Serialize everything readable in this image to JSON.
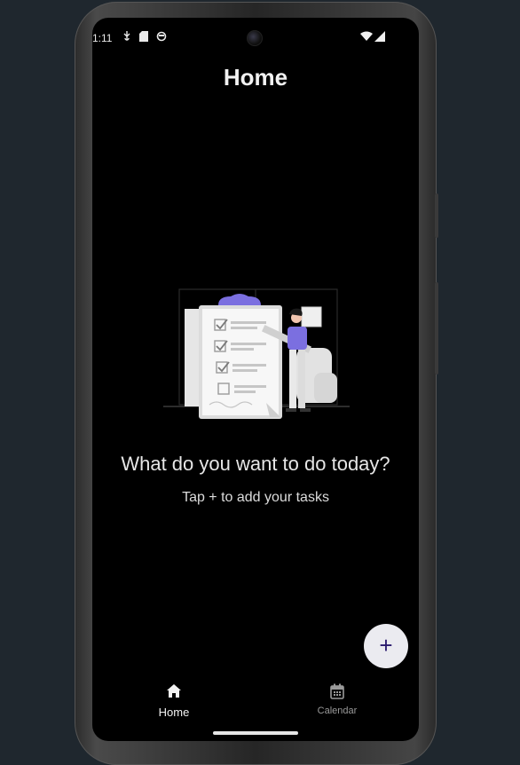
{
  "status_bar": {
    "time": "1:11",
    "icons": [
      "usb-debug-icon",
      "sd-card-icon",
      "sync-icon",
      "wifi-icon",
      "cellular-signal-icon"
    ]
  },
  "header": {
    "title": "Home"
  },
  "empty_state": {
    "illustration": "task-checklist-illustration",
    "headline": "What do you want to do today?",
    "subline": "Tap + to add your tasks"
  },
  "fab": {
    "label": "+",
    "icon": "plus-icon"
  },
  "bottom_nav": [
    {
      "label": "Home",
      "icon": "home-icon",
      "selected": true
    },
    {
      "label": "Calendar",
      "icon": "calendar-icon",
      "selected": false
    }
  ],
  "colors": {
    "background": "#000000",
    "outer": "#1f272e",
    "fab_bg": "#ebebf0",
    "fab_fg": "#2a1a6e",
    "accent_purple": "#7b6fe0"
  }
}
